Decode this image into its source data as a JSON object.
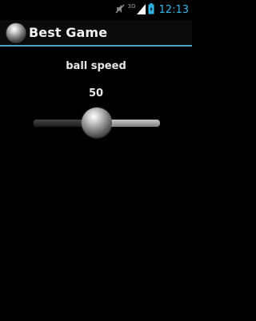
{
  "status_bar": {
    "network_type": "3G",
    "time": "12:13",
    "icons": [
      "mute-icon",
      "signal-icon",
      "battery-icon"
    ]
  },
  "action_bar": {
    "title": "Best Game",
    "icon": "ball-icon",
    "divider_color": "#4fa3c7"
  },
  "setting": {
    "label": "ball speed",
    "value": "50",
    "slider_fraction": 0.5,
    "accent_color": "#33b5e5"
  }
}
